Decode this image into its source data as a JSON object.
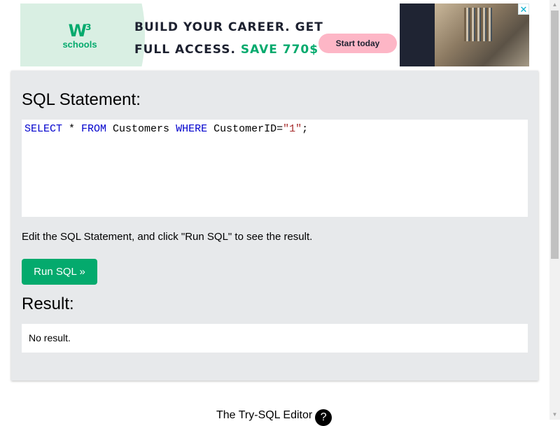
{
  "ad": {
    "logo_mark": "W",
    "logo_sup": "3",
    "logo_text": "schools",
    "headline_line1": "BUILD YOUR CAREER. GET",
    "headline_line2": "FULL ACCESS.",
    "headline_save": "SAVE 770$",
    "cta_label": "Start today",
    "close_icon": "✕",
    "accent_color": "#04AA6D",
    "cta_color": "#fdb6c6"
  },
  "editor": {
    "heading": "SQL Statement:",
    "code": {
      "kw1": "SELECT",
      "t1": " * ",
      "kw2": "FROM",
      "t2": " Customers ",
      "kw3": "WHERE",
      "t3": " CustomerID=",
      "str": "\"1\"",
      "t4": ";"
    },
    "hint": "Edit the SQL Statement, and click \"Run SQL\" to see the result.",
    "run_label": "Run SQL »"
  },
  "result": {
    "heading": "Result:",
    "text": "No result."
  },
  "footer": {
    "label": "The Try-SQL Editor",
    "help_icon": "?"
  },
  "scrollbar": {
    "up_icon": "▲",
    "down_icon": "▼"
  }
}
